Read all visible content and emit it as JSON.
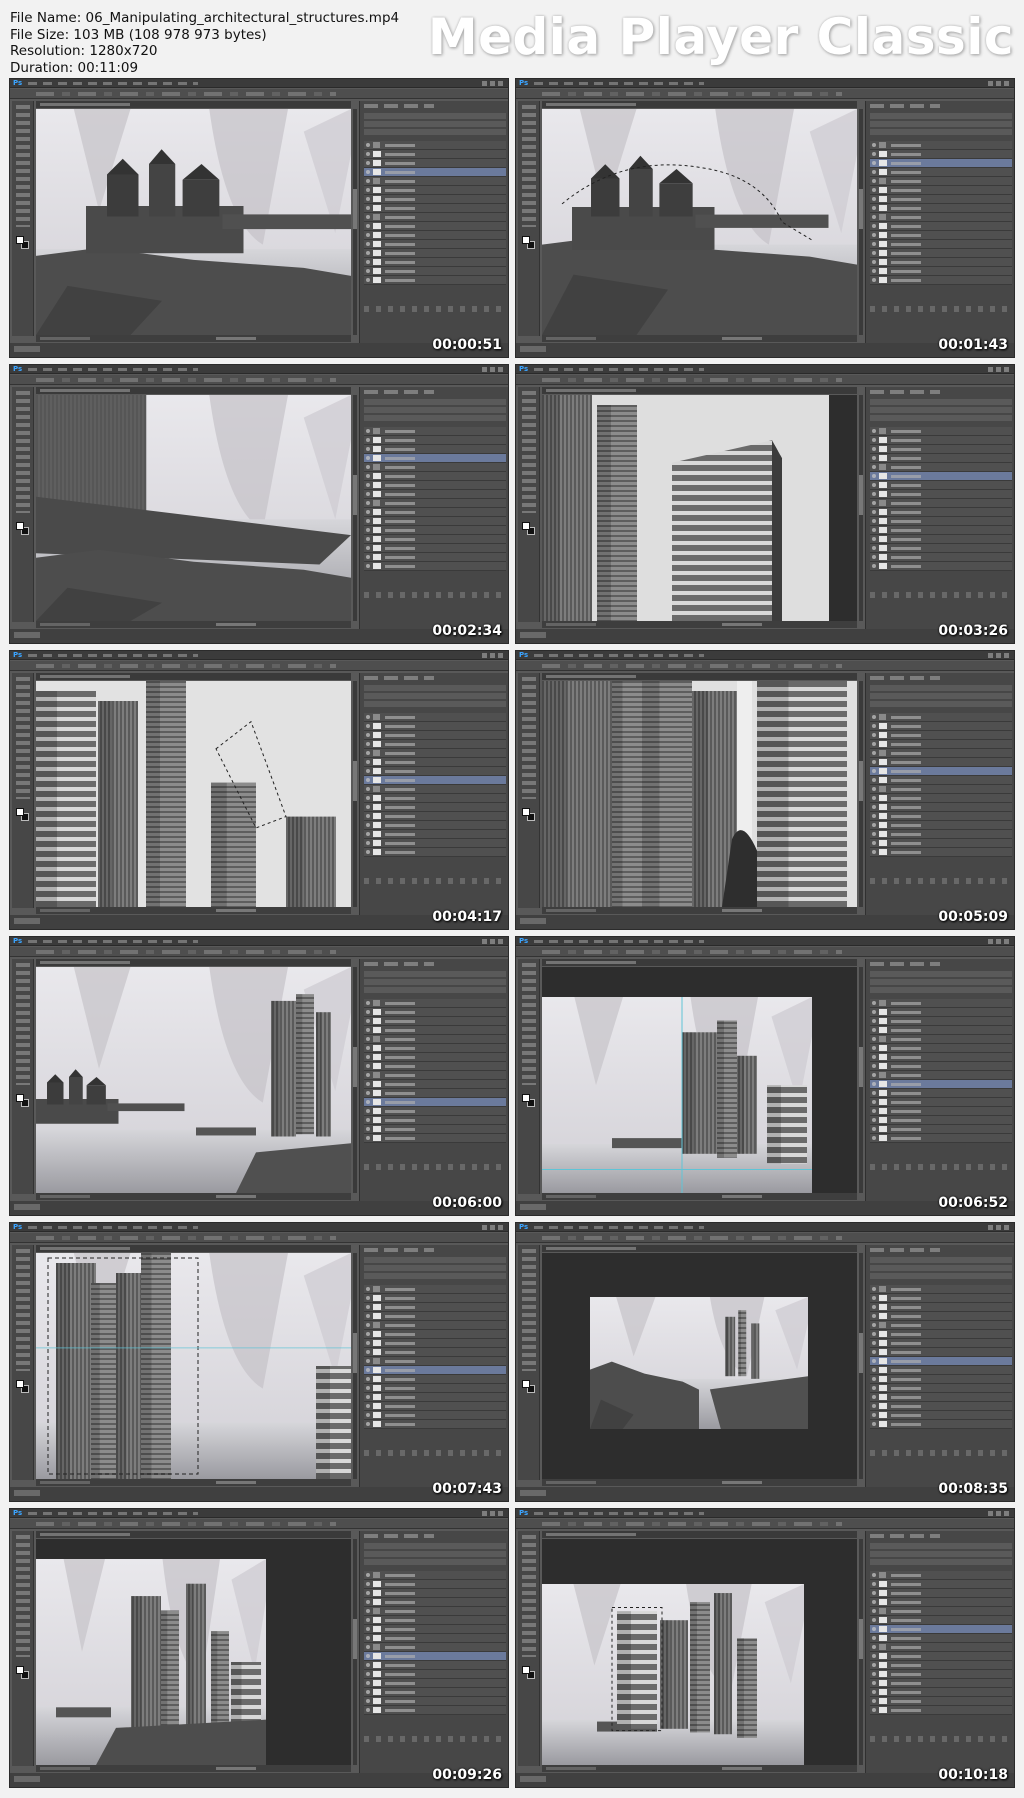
{
  "header": {
    "file_name": "File Name: 06_Manipulating_architectural_structures.mp4",
    "file_size": "File Size: 103 MB (108 978 973 bytes)",
    "resolution": "Resolution: 1280x720",
    "duration": "Duration: 00:11:09",
    "brand": "Media Player Classic"
  },
  "app": {
    "logo": "Ps"
  },
  "thumbnails": [
    {
      "timestamp": "00:00:51",
      "scene": "castle"
    },
    {
      "timestamp": "00:01:43",
      "scene": "castle-select"
    },
    {
      "timestamp": "00:02:34",
      "scene": "castle-zoom"
    },
    {
      "timestamp": "00:03:26",
      "scene": "city"
    },
    {
      "timestamp": "00:04:17",
      "scene": "city-lasso"
    },
    {
      "timestamp": "00:05:09",
      "scene": "city-tall"
    },
    {
      "timestamp": "00:06:00",
      "scene": "comp-wide"
    },
    {
      "timestamp": "00:06:52",
      "scene": "comp-guides"
    },
    {
      "timestamp": "00:07:43",
      "scene": "city-transform"
    },
    {
      "timestamp": "00:08:35",
      "scene": "comp-small"
    },
    {
      "timestamp": "00:09:26",
      "scene": "comp-city"
    },
    {
      "timestamp": "00:10:18",
      "scene": "comp-final"
    }
  ]
}
